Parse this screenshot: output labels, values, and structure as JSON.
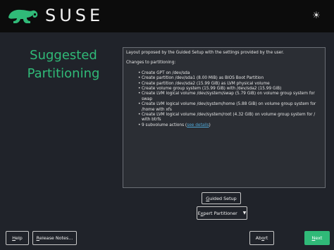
{
  "header": {
    "brand": "SUSE",
    "theme_toggle_glyph": "☀",
    "theme_toggle_icon": "sun-icon",
    "brand_color": "#30ba78"
  },
  "title": {
    "line1": "Suggested",
    "line2": "Partitioning"
  },
  "summary": {
    "intro": "Layout proposed by the Guided Setup with the settings provided by the user.",
    "changes_heading": "Changes to partitioning:",
    "items": [
      "Create GPT on /dev/sda",
      "Create partition /dev/sda1 (8.00 MiB) as BIOS Boot Partition",
      "Create partition /dev/sda2 (15.99 GiB) as LVM physical volume",
      "Create volume group system (15.99 GiB) with /dev/sda2 (15.99 GiB)",
      "Create LVM logical volume /dev/system/swap (5.79 GiB) on volume group system for swap",
      "Create LVM logical volume /dev/system/home (5.88 GiB) on volume group system for /home with xfs",
      "Create LVM logical volume /dev/system/root (4.32 GiB) on volume group system for / with btrfs"
    ],
    "subvolume_prefix": "9 subvolume actions (",
    "subvolume_link": "see details",
    "subvolume_suffix": ")"
  },
  "buttons": {
    "guided_setup_hotkey": "G",
    "guided_setup_rest": "uided Setup",
    "expert_hotkey": "x",
    "expert_pre": "E",
    "expert_rest": "pert Partitioner",
    "expert_arrow": "▼",
    "help_hotkey": "H",
    "help_rest": "elp",
    "release_notes_hotkey": "R",
    "release_notes_rest": "elease Notes...",
    "abort_pre": "Ab",
    "abort_hotkey": "o",
    "abort_rest": "rt",
    "next_hotkey": "N",
    "next_rest": "ext"
  }
}
